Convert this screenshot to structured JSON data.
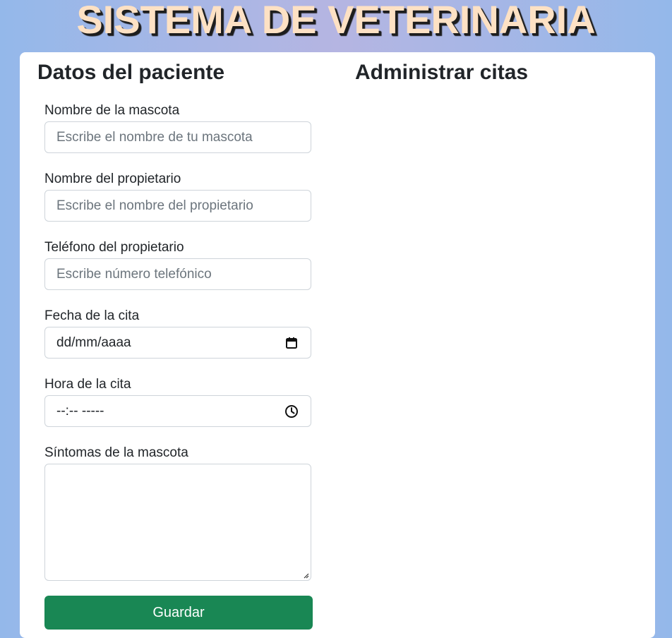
{
  "app": {
    "title": "SISTEMA DE VETERINARIA"
  },
  "form": {
    "title": "Datos del paciente",
    "pet_name": {
      "label": "Nombre de la mascota",
      "placeholder": "Escribe el nombre de tu mascota",
      "value": ""
    },
    "owner_name": {
      "label": "Nombre del propietario",
      "placeholder": "Escribe el nombre del propietario",
      "value": ""
    },
    "owner_phone": {
      "label": "Teléfono del propietario",
      "placeholder": "Escribe número telefónico",
      "value": ""
    },
    "date": {
      "label": "Fecha de la cita",
      "display": "dd/mm/aaaa",
      "icon": "calendar-icon"
    },
    "time": {
      "label": "Hora de la cita",
      "display": "--:-- -----",
      "icon": "clock-icon"
    },
    "symptoms": {
      "label": "Síntomas de la mascota",
      "value": ""
    },
    "save_label": "Guardar"
  },
  "appointments": {
    "title": "Administrar citas"
  },
  "colors": {
    "title_text": "#fde1c4",
    "title_shadow": "#1d1d1d",
    "save_button": "#198754",
    "background": "#b5b5e2"
  }
}
